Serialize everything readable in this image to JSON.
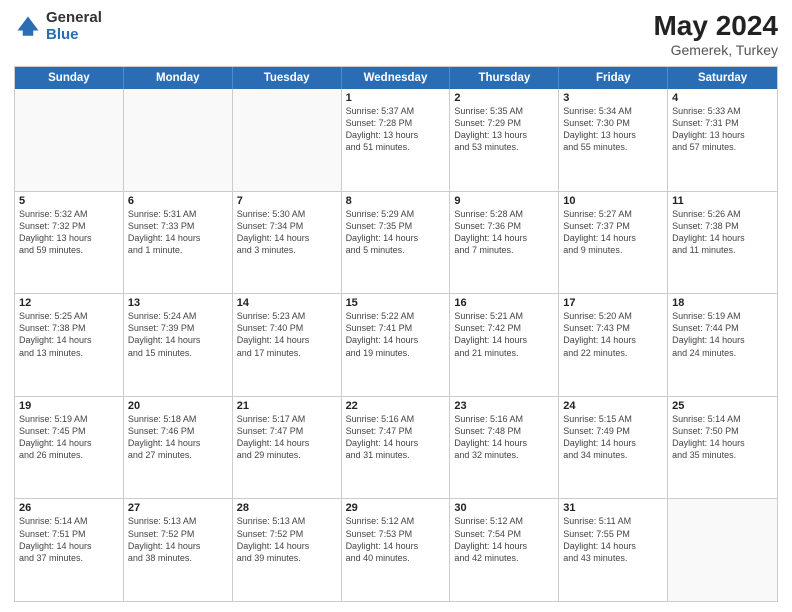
{
  "header": {
    "logo_general": "General",
    "logo_blue": "Blue",
    "month_title": "May 2024",
    "location": "Gemerek, Turkey"
  },
  "day_headers": [
    "Sunday",
    "Monday",
    "Tuesday",
    "Wednesday",
    "Thursday",
    "Friday",
    "Saturday"
  ],
  "weeks": [
    {
      "cells": [
        {
          "date": "",
          "info": "",
          "empty": true
        },
        {
          "date": "",
          "info": "",
          "empty": true
        },
        {
          "date": "",
          "info": "",
          "empty": true
        },
        {
          "date": "1",
          "info": "Sunrise: 5:37 AM\nSunset: 7:28 PM\nDaylight: 13 hours\nand 51 minutes."
        },
        {
          "date": "2",
          "info": "Sunrise: 5:35 AM\nSunset: 7:29 PM\nDaylight: 13 hours\nand 53 minutes."
        },
        {
          "date": "3",
          "info": "Sunrise: 5:34 AM\nSunset: 7:30 PM\nDaylight: 13 hours\nand 55 minutes."
        },
        {
          "date": "4",
          "info": "Sunrise: 5:33 AM\nSunset: 7:31 PM\nDaylight: 13 hours\nand 57 minutes."
        }
      ]
    },
    {
      "cells": [
        {
          "date": "5",
          "info": "Sunrise: 5:32 AM\nSunset: 7:32 PM\nDaylight: 13 hours\nand 59 minutes."
        },
        {
          "date": "6",
          "info": "Sunrise: 5:31 AM\nSunset: 7:33 PM\nDaylight: 14 hours\nand 1 minute."
        },
        {
          "date": "7",
          "info": "Sunrise: 5:30 AM\nSunset: 7:34 PM\nDaylight: 14 hours\nand 3 minutes."
        },
        {
          "date": "8",
          "info": "Sunrise: 5:29 AM\nSunset: 7:35 PM\nDaylight: 14 hours\nand 5 minutes."
        },
        {
          "date": "9",
          "info": "Sunrise: 5:28 AM\nSunset: 7:36 PM\nDaylight: 14 hours\nand 7 minutes."
        },
        {
          "date": "10",
          "info": "Sunrise: 5:27 AM\nSunset: 7:37 PM\nDaylight: 14 hours\nand 9 minutes."
        },
        {
          "date": "11",
          "info": "Sunrise: 5:26 AM\nSunset: 7:38 PM\nDaylight: 14 hours\nand 11 minutes."
        }
      ]
    },
    {
      "cells": [
        {
          "date": "12",
          "info": "Sunrise: 5:25 AM\nSunset: 7:38 PM\nDaylight: 14 hours\nand 13 minutes."
        },
        {
          "date": "13",
          "info": "Sunrise: 5:24 AM\nSunset: 7:39 PM\nDaylight: 14 hours\nand 15 minutes."
        },
        {
          "date": "14",
          "info": "Sunrise: 5:23 AM\nSunset: 7:40 PM\nDaylight: 14 hours\nand 17 minutes."
        },
        {
          "date": "15",
          "info": "Sunrise: 5:22 AM\nSunset: 7:41 PM\nDaylight: 14 hours\nand 19 minutes."
        },
        {
          "date": "16",
          "info": "Sunrise: 5:21 AM\nSunset: 7:42 PM\nDaylight: 14 hours\nand 21 minutes."
        },
        {
          "date": "17",
          "info": "Sunrise: 5:20 AM\nSunset: 7:43 PM\nDaylight: 14 hours\nand 22 minutes."
        },
        {
          "date": "18",
          "info": "Sunrise: 5:19 AM\nSunset: 7:44 PM\nDaylight: 14 hours\nand 24 minutes."
        }
      ]
    },
    {
      "cells": [
        {
          "date": "19",
          "info": "Sunrise: 5:19 AM\nSunset: 7:45 PM\nDaylight: 14 hours\nand 26 minutes."
        },
        {
          "date": "20",
          "info": "Sunrise: 5:18 AM\nSunset: 7:46 PM\nDaylight: 14 hours\nand 27 minutes."
        },
        {
          "date": "21",
          "info": "Sunrise: 5:17 AM\nSunset: 7:47 PM\nDaylight: 14 hours\nand 29 minutes."
        },
        {
          "date": "22",
          "info": "Sunrise: 5:16 AM\nSunset: 7:47 PM\nDaylight: 14 hours\nand 31 minutes."
        },
        {
          "date": "23",
          "info": "Sunrise: 5:16 AM\nSunset: 7:48 PM\nDaylight: 14 hours\nand 32 minutes."
        },
        {
          "date": "24",
          "info": "Sunrise: 5:15 AM\nSunset: 7:49 PM\nDaylight: 14 hours\nand 34 minutes."
        },
        {
          "date": "25",
          "info": "Sunrise: 5:14 AM\nSunset: 7:50 PM\nDaylight: 14 hours\nand 35 minutes."
        }
      ]
    },
    {
      "cells": [
        {
          "date": "26",
          "info": "Sunrise: 5:14 AM\nSunset: 7:51 PM\nDaylight: 14 hours\nand 37 minutes."
        },
        {
          "date": "27",
          "info": "Sunrise: 5:13 AM\nSunset: 7:52 PM\nDaylight: 14 hours\nand 38 minutes."
        },
        {
          "date": "28",
          "info": "Sunrise: 5:13 AM\nSunset: 7:52 PM\nDaylight: 14 hours\nand 39 minutes."
        },
        {
          "date": "29",
          "info": "Sunrise: 5:12 AM\nSunset: 7:53 PM\nDaylight: 14 hours\nand 40 minutes."
        },
        {
          "date": "30",
          "info": "Sunrise: 5:12 AM\nSunset: 7:54 PM\nDaylight: 14 hours\nand 42 minutes."
        },
        {
          "date": "31",
          "info": "Sunrise: 5:11 AM\nSunset: 7:55 PM\nDaylight: 14 hours\nand 43 minutes."
        },
        {
          "date": "",
          "info": "",
          "empty": true
        }
      ]
    }
  ]
}
